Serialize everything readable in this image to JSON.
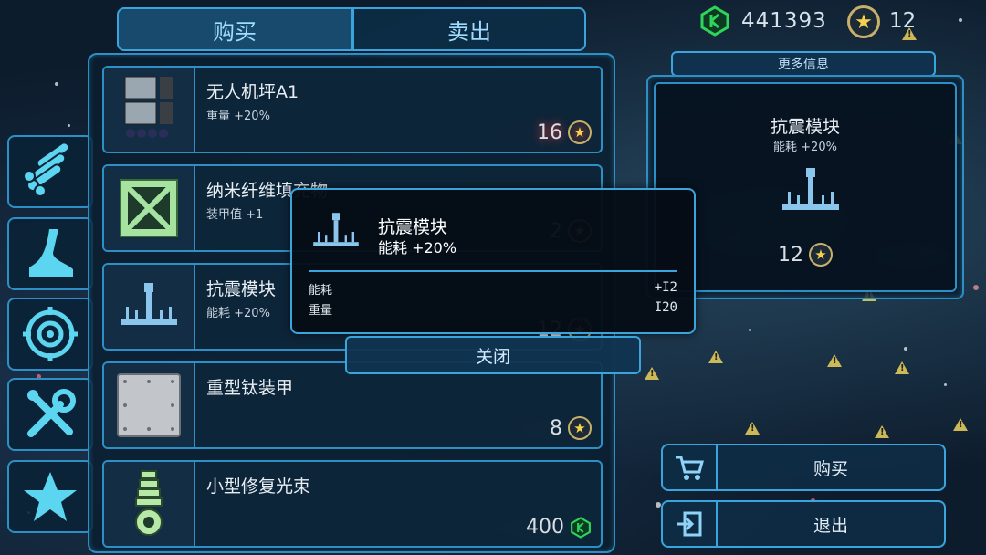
{
  "tabs": {
    "buy": "购买",
    "sell": "卖出"
  },
  "currency": {
    "gems": "441393",
    "stars": "12"
  },
  "categories": [
    "pipes-icon",
    "boot-icon",
    "target-icon",
    "tools-icon",
    "star-icon"
  ],
  "items": [
    {
      "name": "无人机坪A1",
      "stat": "重量 +20%",
      "price": "16",
      "currency": "star",
      "glow": "red"
    },
    {
      "name": "纳米纤维填充物",
      "stat": "装甲值 +1",
      "price": "2",
      "currency": "star"
    },
    {
      "name": "抗震模块",
      "stat": "能耗 +20%",
      "price": "12",
      "currency": "star"
    },
    {
      "name": "重型钛装甲",
      "stat": "",
      "price": "8",
      "currency": "star",
      "glow": "gold"
    },
    {
      "name": "小型修复光束",
      "stat": "",
      "price": "400",
      "currency": "gem",
      "glow": "green"
    }
  ],
  "detail": {
    "more_info": "更多信息",
    "name": "抗震模块",
    "stat": "能耗 +20%",
    "price": "12"
  },
  "actions": {
    "buy": "购买",
    "exit": "退出"
  },
  "popup": {
    "name": "抗震模块",
    "stat": "能耗  +20%",
    "rows": [
      {
        "label": "能耗",
        "value": "+I2"
      },
      {
        "label": "重量",
        "value": "I20"
      }
    ],
    "close": "关闭"
  },
  "colors": {
    "accent": "#3aa4dc",
    "gem": "#2fd45a",
    "star": "#f4d24d"
  }
}
